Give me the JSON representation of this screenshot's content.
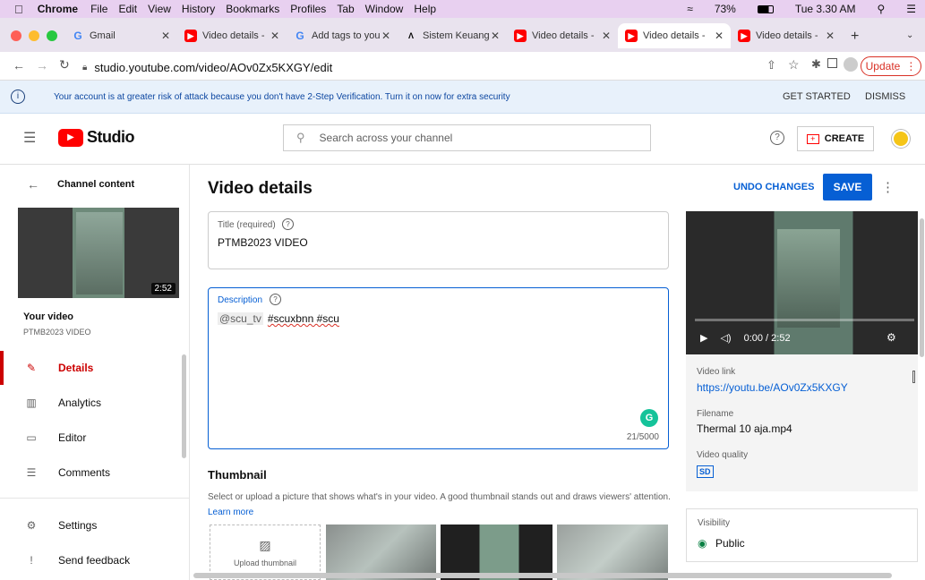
{
  "macbar": {
    "app": "Chrome",
    "menus": [
      "File",
      "Edit",
      "View",
      "History",
      "Bookmarks",
      "Profiles",
      "Tab",
      "Window",
      "Help"
    ],
    "battery": "73%",
    "clock": "Tue 3.30 AM"
  },
  "tabs": [
    {
      "title": "Gmail",
      "icon": "gmail-icon"
    },
    {
      "title": "Video details - ",
      "icon": "youtube-icon"
    },
    {
      "title": "Add tags to you",
      "icon": "google-icon"
    },
    {
      "title": "Sistem Keuang",
      "icon": "app-icon"
    },
    {
      "title": "Video details - ",
      "icon": "youtube-icon"
    },
    {
      "title": "Video details - ",
      "icon": "youtube-icon"
    },
    {
      "title": "Video details - ",
      "icon": "youtube-icon"
    }
  ],
  "address": {
    "url": "studio.youtube.com/video/AOv0Zx5KXGY/edit",
    "update_label": "Update"
  },
  "banner": {
    "text": "Your account is at greater risk of attack because you don't have 2-Step Verification. Turn it on now for extra security",
    "get_started": "GET STARTED",
    "dismiss": "DISMISS"
  },
  "header": {
    "logo": "Studio",
    "search_placeholder": "Search across your channel",
    "create_label": "CREATE"
  },
  "sidebar": {
    "back_label": "Channel content",
    "thumb_duration": "2:52",
    "your_video": "Your video",
    "video_title": "PTMB2023 VIDEO",
    "items": [
      {
        "label": "Details"
      },
      {
        "label": "Analytics"
      },
      {
        "label": "Editor"
      },
      {
        "label": "Comments"
      },
      {
        "label": "Settings"
      },
      {
        "label": "Send feedback"
      }
    ]
  },
  "main": {
    "page_title": "Video details",
    "undo_label": "UNDO CHANGES",
    "save_label": "SAVE",
    "title_label": "Title (required)",
    "title_value": "PTMB2023 VIDEO",
    "desc_label": "Description",
    "desc_handle": "@scu_tv",
    "desc_tags": "#scuxbnn #scu",
    "desc_count": "21/5000",
    "thumb_heading": "Thumbnail",
    "thumb_help": "Select or upload a picture that shows what's in your video. A good thumbnail stands out and draws viewers' attention.",
    "learn_more": "Learn more",
    "upload_thumb": "Upload thumbnail"
  },
  "player": {
    "time": "0:00 / 2:52"
  },
  "info": {
    "link_label": "Video link",
    "link_value": "https://youtu.be/AOv0Zx5KXGY",
    "file_label": "Filename",
    "file_value": "Thermal 10 aja.mp4",
    "quality_label": "Video quality",
    "quality_value": "SD",
    "visibility_label": "Visibility",
    "visibility_value": "Public"
  },
  "colors": {
    "accent": "#065fd4",
    "youtube_red": "#ff0000",
    "banner_bg": "#e8f1fb"
  }
}
